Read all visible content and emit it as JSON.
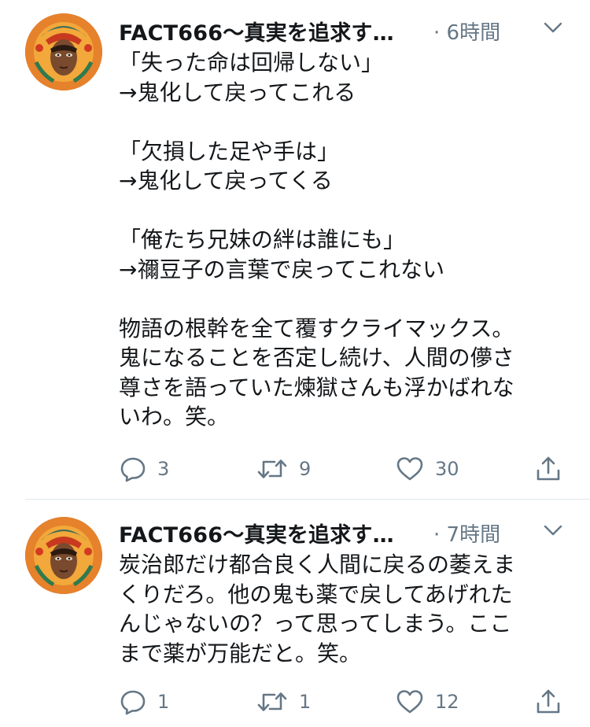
{
  "colors": {
    "text": "#14171a",
    "muted": "#657786",
    "divider": "#e1e8ed",
    "background": "#ffffff"
  },
  "tweets": [
    {
      "author": "FACT666〜真実を追求す…",
      "time": "· 6時間",
      "text": "「失った命は回帰しない」\n→鬼化して戻ってこれる\n\n「欠損した足や手は」\n→鬼化して戻ってくる\n\n「俺たち兄妹の絆は誰にも」\n→禰豆子の言葉で戻ってこれない\n\n物語の根幹を全て覆すクライマックス。\n鬼になることを否定し続け、人間の儚さ\n尊さを語っていた煉獄さんも浮かばれな\nいわ。笑。",
      "replies": "3",
      "retweets": "9",
      "likes": "30",
      "icons": {
        "avatar": "avatar-image",
        "menu": "chevron-down-icon",
        "reply": "reply-icon",
        "retweet": "retweet-icon",
        "like": "heart-icon",
        "share": "share-icon"
      }
    },
    {
      "author": "FACT666〜真実を追求す…",
      "time": "· 7時間",
      "text": "炭治郎だけ都合良く人間に戻るの萎えま\nくりだろ。他の鬼も薬で戻してあげれた\nんじゃないの？って思ってしまう。ここ\nまで薬が万能だと。笑。",
      "replies": "1",
      "retweets": "1",
      "likes": "12",
      "icons": {
        "avatar": "avatar-image",
        "menu": "chevron-down-icon",
        "reply": "reply-icon",
        "retweet": "retweet-icon",
        "like": "heart-icon",
        "share": "share-icon"
      }
    }
  ]
}
